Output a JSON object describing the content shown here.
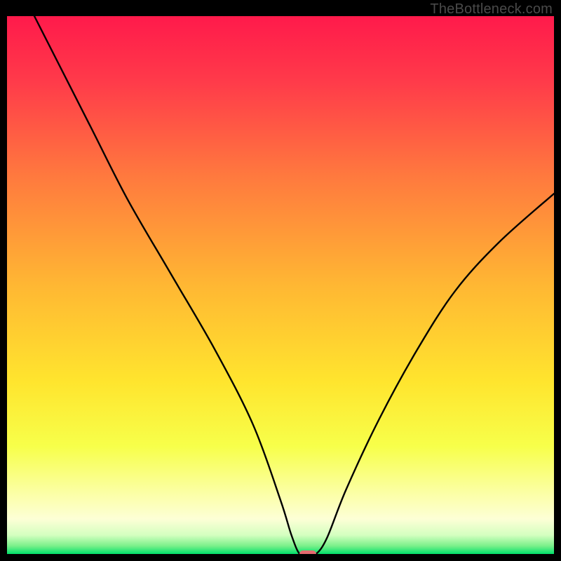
{
  "watermark": "TheBottleneck.com",
  "chart_data": {
    "type": "line",
    "title": "",
    "xlabel": "",
    "ylabel": "",
    "xlim": [
      0,
      100
    ],
    "ylim": [
      0,
      100
    ],
    "curve": {
      "x": [
        5,
        15,
        22,
        30,
        38,
        45,
        50,
        52,
        53.5,
        55,
        56.5,
        58.5,
        62,
        68,
        75,
        82,
        90,
        100
      ],
      "y": [
        100,
        80,
        66,
        52,
        38,
        24,
        10,
        3.5,
        0,
        0,
        0,
        3,
        12,
        25,
        38,
        49,
        58,
        67
      ]
    },
    "flat_segment": {
      "x0": 53.5,
      "x1": 56.5,
      "y": 0
    },
    "marker": {
      "x": 55,
      "y": 0,
      "color": "#e46a6f"
    },
    "green_band": {
      "y0": 0,
      "y1": 3,
      "color_top": "#a8f07a",
      "color_bottom": "#00e06a"
    },
    "gradient_stops": [
      {
        "offset": 0.0,
        "color": "#ff1a4b"
      },
      {
        "offset": 0.12,
        "color": "#ff3a4a"
      },
      {
        "offset": 0.3,
        "color": "#ff7a3e"
      },
      {
        "offset": 0.5,
        "color": "#ffb733"
      },
      {
        "offset": 0.68,
        "color": "#ffe52e"
      },
      {
        "offset": 0.8,
        "color": "#f7ff4a"
      },
      {
        "offset": 0.88,
        "color": "#fbff9e"
      },
      {
        "offset": 0.935,
        "color": "#fdffd6"
      },
      {
        "offset": 0.965,
        "color": "#d4ffc0"
      },
      {
        "offset": 0.985,
        "color": "#7af08a"
      },
      {
        "offset": 1.0,
        "color": "#00e06a"
      }
    ]
  }
}
